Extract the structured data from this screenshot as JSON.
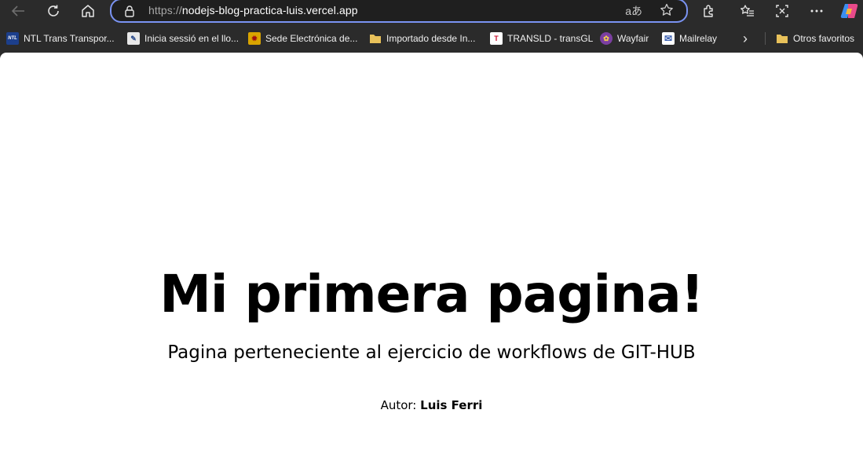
{
  "browser": {
    "address": {
      "scheme": "https://",
      "host": "nodejs-blog-practica-luis.vercel.app",
      "read_aloud_glyph": "aあ"
    },
    "toolbar_icons": [
      "back-icon",
      "refresh-icon",
      "home-icon",
      "lock-icon",
      "read-aloud-icon",
      "add-favorite-icon",
      "extensions-icon",
      "favorites-icon",
      "screenshot-icon",
      "more-icon",
      "copilot-icon"
    ],
    "bookmarks": [
      {
        "label": "NTL Trans  Transpor...",
        "icon": "NTL",
        "color": "#1c3f8c"
      },
      {
        "label": "Inicia sessió en el llo...",
        "icon": "✎",
        "color": "#e8e8e8"
      },
      {
        "label": "Sede Electrónica de...",
        "icon": "✹",
        "color": "#d9a400"
      },
      {
        "label": "Importado desde In...",
        "icon": "folder",
        "color": "#e8c15a"
      },
      {
        "label": "TRANSLD - transGL",
        "icon": "T",
        "color": "#c8102e"
      },
      {
        "label": "Wayfair",
        "icon": "✿",
        "color": "#7b3fa0"
      },
      {
        "label": "Mailrelay",
        "icon": "✉",
        "color": "#3a5fb0"
      }
    ],
    "bookmarks_overflow": "›",
    "other_favorites": "Otros favoritos"
  },
  "page": {
    "title": "Mi primera pagina!",
    "subtitle": "Pagina perteneciente al ejercicio de workflows de GIT-HUB",
    "author_label": "Autor:",
    "author_name": "Luis Ferri"
  }
}
